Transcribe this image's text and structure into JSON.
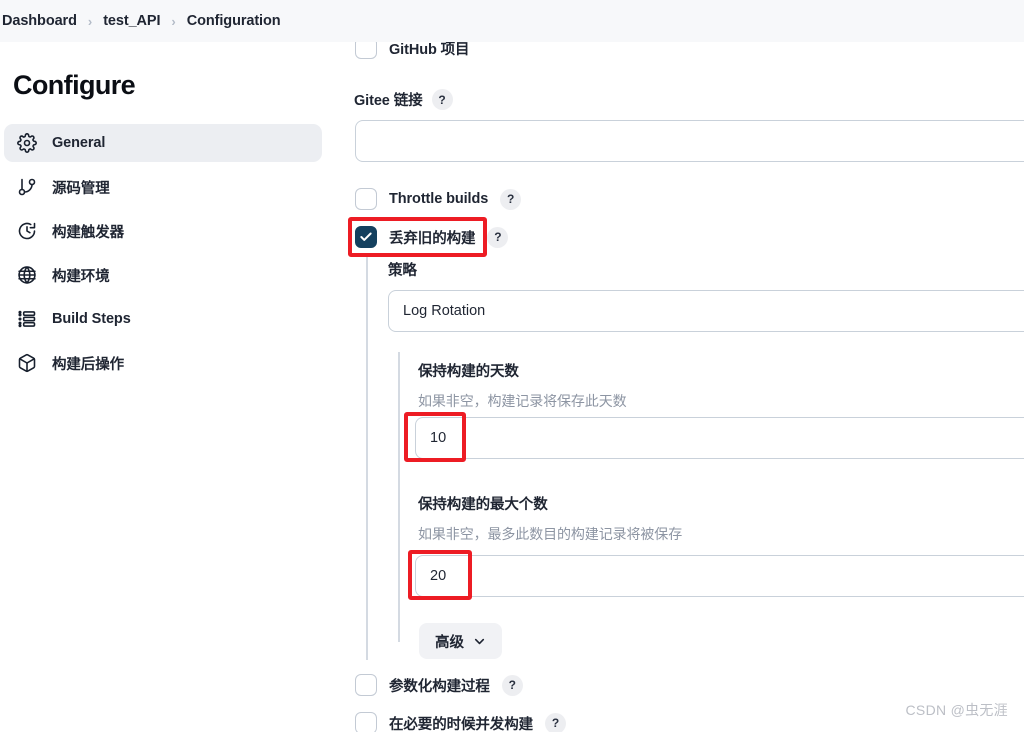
{
  "breadcrumb": {
    "items": [
      "Dashboard",
      "test_API",
      "Configuration"
    ],
    "separator": "›"
  },
  "sidebar": {
    "title": "Configure",
    "items": [
      {
        "label": "General",
        "icon": "gear-icon",
        "active": true
      },
      {
        "label": "源码管理",
        "icon": "git-branch-icon",
        "active": false
      },
      {
        "label": "构建触发器",
        "icon": "clock-icon",
        "active": false
      },
      {
        "label": "构建环境",
        "icon": "globe-icon",
        "active": false
      },
      {
        "label": "Build Steps",
        "icon": "steps-list-icon",
        "active": false
      },
      {
        "label": "构建后操作",
        "icon": "package-icon",
        "active": false
      }
    ]
  },
  "form": {
    "github_project": {
      "label": "GitHub 项目",
      "checked": false
    },
    "gitee_link": {
      "label": "Gitee 链接",
      "help": "?",
      "value": "",
      "placeholder": ""
    },
    "throttle_builds": {
      "label": "Throttle builds",
      "help": "?",
      "checked": false
    },
    "discard_old_builds": {
      "label": "丢弃旧的构建",
      "help": "?",
      "checked": true,
      "strategy_label": "策略",
      "strategy_value": "Log Rotation",
      "days_to_keep": {
        "label": "保持构建的天数",
        "description": "如果非空，构建记录将保存此天数",
        "value": "10"
      },
      "max_builds_to_keep": {
        "label": "保持构建的最大个数",
        "description": "如果非空，最多此数目的构建记录将被保存",
        "value": "20"
      },
      "advanced_button": "高级"
    },
    "parameterized_build": {
      "label": "参数化构建过程",
      "help": "?",
      "checked": false
    },
    "concurrent_build": {
      "label": "在必要的时候并发构建",
      "help": "?",
      "checked": false
    }
  },
  "annotations": {
    "color": "#ed1c24",
    "targets": [
      "discard-old-builds-checkbox",
      "days-to-keep-input",
      "max-builds-to-keep-input"
    ]
  },
  "watermark": "CSDN @虫无涯"
}
